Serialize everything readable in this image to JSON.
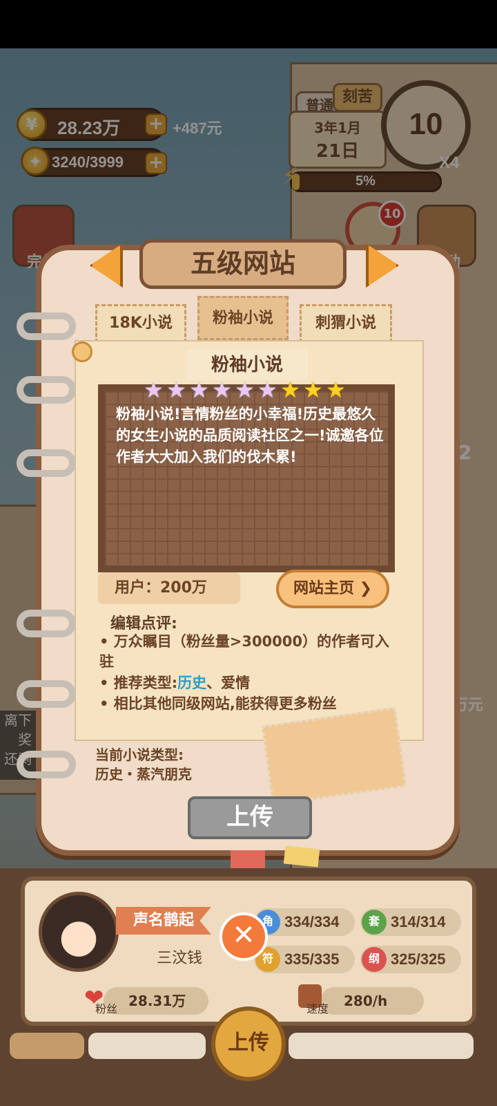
{
  "hud": {
    "money": "28.23万",
    "money_gain": "+487元",
    "energy": "3240/3999",
    "mode_normal": "普通",
    "mode_hard": "刻苦",
    "date_year_month": "3年1月",
    "date_day": "21日",
    "clock_value": "10",
    "multiplier": "X4",
    "progress_label": "5%",
    "progress": 0.05
  },
  "side": {
    "left_label_1": "完结",
    "right_label_action": "行动",
    "right_badge": "10",
    "right_num": "2",
    "right_money": "万元",
    "left_bottom_1": "离下",
    "left_bottom_2": "奖",
    "left_bottom_3": "还剩"
  },
  "panel": {
    "title": "五级网站",
    "tabs": [
      "18K小说",
      "粉袖小说",
      "刺猬小说"
    ],
    "active_tab": 1,
    "site_name": "粉袖小说",
    "rating": 9,
    "rainbow_stars": 6,
    "gold_stars": 3,
    "description": "粉袖小说!言情粉丝的小幸福!历史最悠久的女生小说的品质阅读社区之一!诚邀各位作者大大加入我们的伐木累!",
    "users_label": "用户：200万",
    "home_button": "网站主页",
    "review_title": "编辑点评:",
    "review_1": "万众瞩目（粉丝量>300000）的作者可入驻",
    "review_2_prefix": "推荐类型:",
    "review_2_highlight": "历史",
    "review_2_suffix": "、爱情",
    "review_3": "相比其他同级网站,能获得更多粉丝",
    "current_genre_label": "当前小说类型:",
    "current_genre_value": "历史・蒸汽朋克",
    "upload_button": "上传"
  },
  "profile": {
    "reputation": "声名鹊起",
    "name": "三汶钱",
    "stats": [
      {
        "icon": "角",
        "value": "334/334",
        "color": "#4a8ed6"
      },
      {
        "icon": "套",
        "value": "314/314",
        "color": "#5ba24a"
      },
      {
        "icon": "符",
        "value": "335/335",
        "color": "#e0a12e"
      },
      {
        "icon": "纲",
        "value": "325/325",
        "color": "#d9534f"
      }
    ],
    "fans_label": "粉丝",
    "fans_value": "28.31万",
    "speed_label": "速度",
    "speed_value": "280/h",
    "upload_button": "上传",
    "close_icon": "close-icon"
  },
  "colors": {
    "accent_orange": "#f4a23a",
    "highlight_blue": "#2a9fc7",
    "panel_bg": "#f0dcc8",
    "frame": "#8b5e42"
  }
}
